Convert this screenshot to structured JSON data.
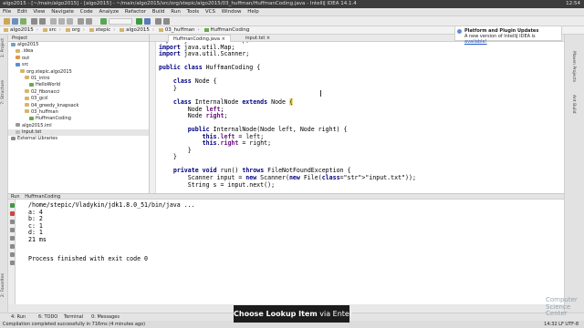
{
  "window": {
    "title": "algo2015 - [~/main/algo2015] - [algo2015] - ~/main/algo2015/src/org/stepic/algo2015/03_huffman/HuffmanCoding.java - IntelliJ IDEA 14.1.4",
    "clock": "12:54"
  },
  "menu": [
    "File",
    "Edit",
    "View",
    "Navigate",
    "Code",
    "Analyze",
    "Refactor",
    "Build",
    "Run",
    "Tools",
    "VCS",
    "Window",
    "Help"
  ],
  "breadcrumbs": [
    "algo2015",
    "src",
    "org",
    "stepic",
    "algo2015",
    "03_huffman",
    "HuffmanCoding"
  ],
  "project": {
    "header": "Project",
    "tree": [
      {
        "label": "algo2015",
        "color": "#7a9cc9",
        "indent": 0
      },
      {
        "label": ".idea",
        "color": "#d7b46a",
        "indent": 1
      },
      {
        "label": "out",
        "color": "#d99a4a",
        "indent": 1
      },
      {
        "label": "src",
        "color": "#5a8fd6",
        "indent": 1
      },
      {
        "label": "org.stepic.algo2015",
        "color": "#d7b46a",
        "indent": 2
      },
      {
        "label": "01_intro",
        "color": "#d7b46a",
        "indent": 3
      },
      {
        "label": "HelloWorld",
        "color": "#6aa84f",
        "indent": 4
      },
      {
        "label": "02_fibonacci",
        "color": "#d7b46a",
        "indent": 3
      },
      {
        "label": "03_gcd",
        "color": "#d7b46a",
        "indent": 3
      },
      {
        "label": "04_greedy_knapsack",
        "color": "#d7b46a",
        "indent": 3
      },
      {
        "label": "03_huffman",
        "color": "#d7b46a",
        "indent": 3
      },
      {
        "label": "HuffmanCoding",
        "color": "#6aa84f",
        "indent": 4
      },
      {
        "label": "algo2015.iml",
        "color": "#999999",
        "indent": 1
      },
      {
        "label": "input.txt",
        "color": "#bbbbbb",
        "indent": 1,
        "selected": true
      },
      {
        "label": "External Libraries",
        "color": "#8a8a8a",
        "indent": 0
      }
    ]
  },
  "tabs": [
    {
      "label": "HuffmanCoding.java",
      "active": true
    },
    {
      "label": "input.txt",
      "active": false
    }
  ],
  "notification": {
    "title": "Platform and Plugin Updates",
    "text": "A new version of IntelliJ IDEA is",
    "link": "available!"
  },
  "code": [
    "import java.util.HashMap;",
    "import java.util.Map;",
    "import java.util.Scanner;",
    "",
    "public class HuffmanCoding {",
    "",
    "    class Node {",
    "    }",
    "",
    "    class InternalNode extends Node {",
    "        Node left;",
    "        Node right;",
    "",
    "        public InternalNode(Node left, Node right) {",
    "            this.left = left;",
    "            this.right = right;",
    "        }",
    "    }",
    "",
    "    private void run() throws FileNotFoundException {",
    "        Scanner input = new Scanner(new File(\"input.txt\"));",
    "        String s = input.next();"
  ],
  "run": {
    "header": "Run",
    "config": "HuffmanCoding",
    "output": [
      "/home/stepic/Vladykin/jdk1.8.0_51/bin/java ...",
      "a: 4",
      "b: 2",
      "c: 1",
      "d: 1",
      "21 ms",
      "",
      "Process finished with exit code 0"
    ]
  },
  "bottom_tabs": [
    "4: Run",
    "6: TODO",
    "Terminal",
    "0: Messages"
  ],
  "status": {
    "left": "Compilation completed successfully in 716ms (4 minutes ago)",
    "right": "14:32  LF  UTF-8"
  },
  "left_strip": [
    "1: Project",
    "7: Structure",
    "2: Favorites"
  ],
  "right_strip": [
    "Maven Projects",
    "Ant Build"
  ],
  "tooltip": {
    "bold": "Choose Lookup Item",
    "rest": "via Enter"
  },
  "watermark": [
    "Computer",
    "Science",
    "Center"
  ]
}
